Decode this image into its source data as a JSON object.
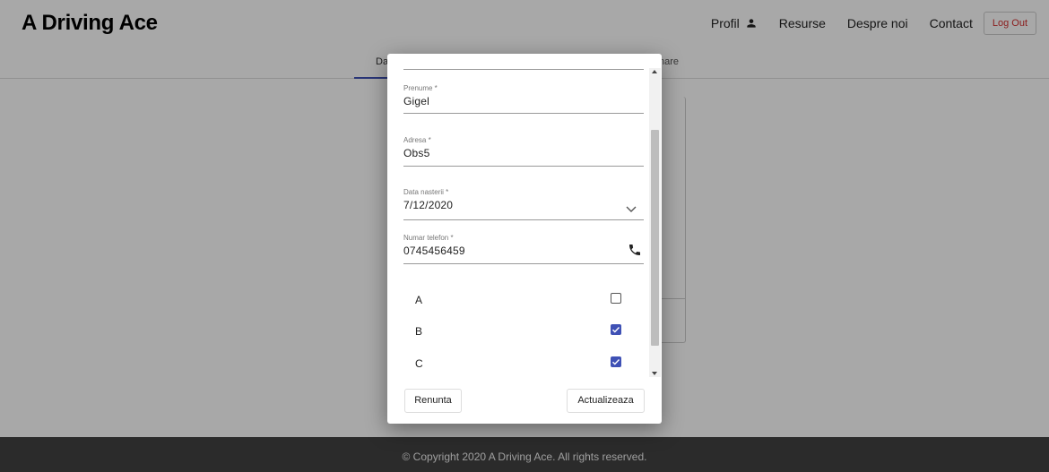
{
  "navbar": {
    "brand": "A Driving Ace",
    "links": [
      "Profil",
      "Resurse",
      "Despre noi",
      "Contact"
    ],
    "logout": "Log Out"
  },
  "tabs": [
    "Da",
    "nare"
  ],
  "footer": {
    "text": "© Copyright 2020 A Driving Ace. All rights reserved."
  },
  "dialog": {
    "fields": {
      "prenume": {
        "label": "Prenume *",
        "value": "Gigel"
      },
      "adresa": {
        "label": "Adresa *",
        "value": "Obs5"
      },
      "data_nasterii": {
        "label": "Data nasterii *",
        "value": "7/12/2020"
      },
      "telefon": {
        "label": "Numar telefon *",
        "value": "0745456459"
      }
    },
    "categories": [
      {
        "label": "A",
        "checked": false
      },
      {
        "label": "B",
        "checked": true
      },
      {
        "label": "C",
        "checked": true
      }
    ],
    "cancel_label": "Renunta",
    "update_label": "Actualizeaza"
  },
  "colors": {
    "accent": "#3f51b5",
    "logout": "#d32f2f",
    "footer_bg": "#424242"
  },
  "icons": {
    "profile": "person-icon",
    "date_picker": "chevron-down-icon",
    "phone": "phone-icon",
    "checkbox": "check-icon"
  }
}
